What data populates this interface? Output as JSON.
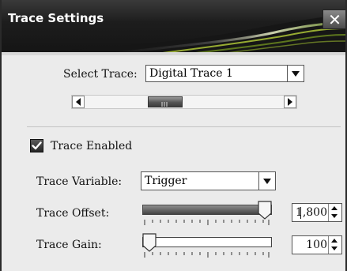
{
  "window": {
    "title": "Trace Settings",
    "close_glyph": "✕"
  },
  "select_trace": {
    "label": "Select Trace:",
    "value": "Digital Trace 1"
  },
  "trace_enabled": {
    "label": "Trace Enabled",
    "checked": true
  },
  "trace_variable": {
    "label": "Trace Variable:",
    "value": "Trigger"
  },
  "trace_offset": {
    "label": "Trace Offset:",
    "value": "1,800",
    "slider_fraction": 1.0
  },
  "trace_gain": {
    "label": "Trace Gain:",
    "value": "100",
    "slider_fraction": 0.0
  },
  "colors": {
    "titlebar": "#1d1d1d",
    "accent_swoosh": "#b8d13a",
    "panel": "#ebebeb"
  },
  "icons": [
    "close-icon",
    "dropdown-arrow-icon",
    "scroll-left-icon",
    "scroll-right-icon",
    "checkmark-icon",
    "spin-up-icon",
    "spin-down-icon"
  ]
}
